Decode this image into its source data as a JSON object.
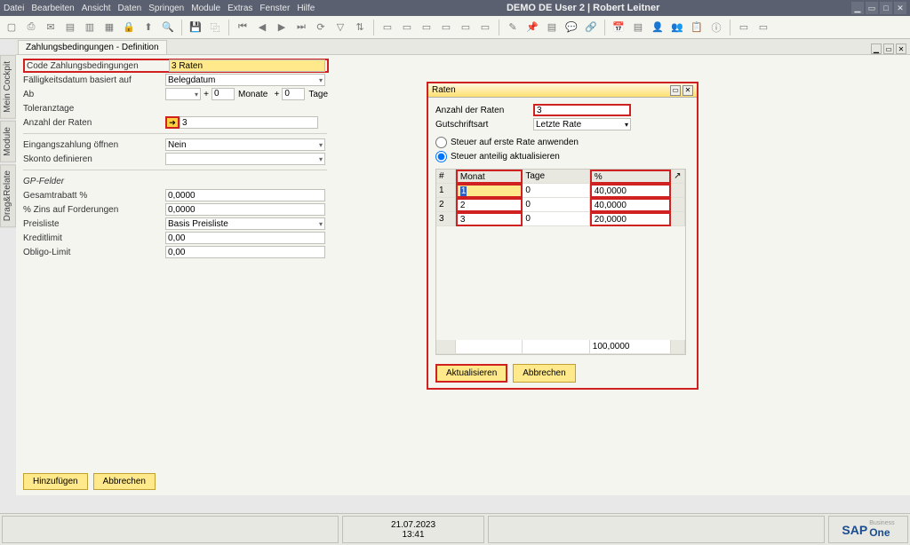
{
  "menubar": {
    "items": [
      "Datei",
      "Bearbeiten",
      "Ansicht",
      "Daten",
      "Springen",
      "Module",
      "Extras",
      "Fenster",
      "Hilfe"
    ],
    "title": "DEMO DE User 2 | Robert Leitner"
  },
  "sideTabs": [
    "Mein Cockpit",
    "Module",
    "Drag&Relate"
  ],
  "docTab": "Zahlungsbedingungen - Definition",
  "form": {
    "code_label": "Code Zahlungsbedingungen",
    "code_value": "3 Raten",
    "due_basis_label": "Fälligkeitsdatum basiert auf",
    "due_basis_value": "Belegdatum",
    "from_label": "Ab",
    "from_v1": "",
    "from_plus1": "+",
    "from_v2": "0",
    "from_unit": "Monate",
    "from_plus2": "+",
    "from_v3": "0",
    "from_unit2": "Tage",
    "tolerance_label": "Toleranztage",
    "rates_count_label": "Anzahl der Raten",
    "rates_count_icon": "➔",
    "rates_count_value": "3",
    "incoming_label": "Eingangszahlung öffnen",
    "incoming_value": "Nein",
    "skonto_label": "Skonto definieren",
    "gp_header": "GP-Felder",
    "discount_label": "Gesamtrabatt %",
    "discount_value": "0,0000",
    "interest_label": "% Zins auf Forderungen",
    "interest_value": "0,0000",
    "pricelist_label": "Preisliste",
    "pricelist_value": "Basis Preisliste",
    "credit_label": "Kreditlimit",
    "credit_value": "0,00",
    "obligo_label": "Obligo-Limit",
    "obligo_value": "0,00",
    "btn_add": "Hinzufügen",
    "btn_cancel": "Abbrechen"
  },
  "popup": {
    "title": "Raten",
    "rates_label": "Anzahl der Raten",
    "rates_value": "3",
    "credit_type_label": "Gutschriftsart",
    "credit_type_value": "Letzte Rate",
    "radio1": "Steuer auf erste Rate anwenden",
    "radio2": "Steuer anteilig aktualisieren",
    "radio_selected": 2,
    "headers": {
      "idx": "#",
      "c1": "Monat",
      "c2": "Tage",
      "c3": "%"
    },
    "rows": [
      {
        "idx": "1",
        "monat": "1",
        "tage": "0",
        "pct": "40,0000"
      },
      {
        "idx": "2",
        "monat": "2",
        "tage": "0",
        "pct": "40,0000"
      },
      {
        "idx": "3",
        "monat": "3",
        "tage": "0",
        "pct": "20,0000"
      }
    ],
    "total": "100,0000",
    "btn_update": "Aktualisieren",
    "btn_cancel": "Abbrechen"
  },
  "statusbar": {
    "date": "21.07.2023",
    "time": "13:41"
  }
}
